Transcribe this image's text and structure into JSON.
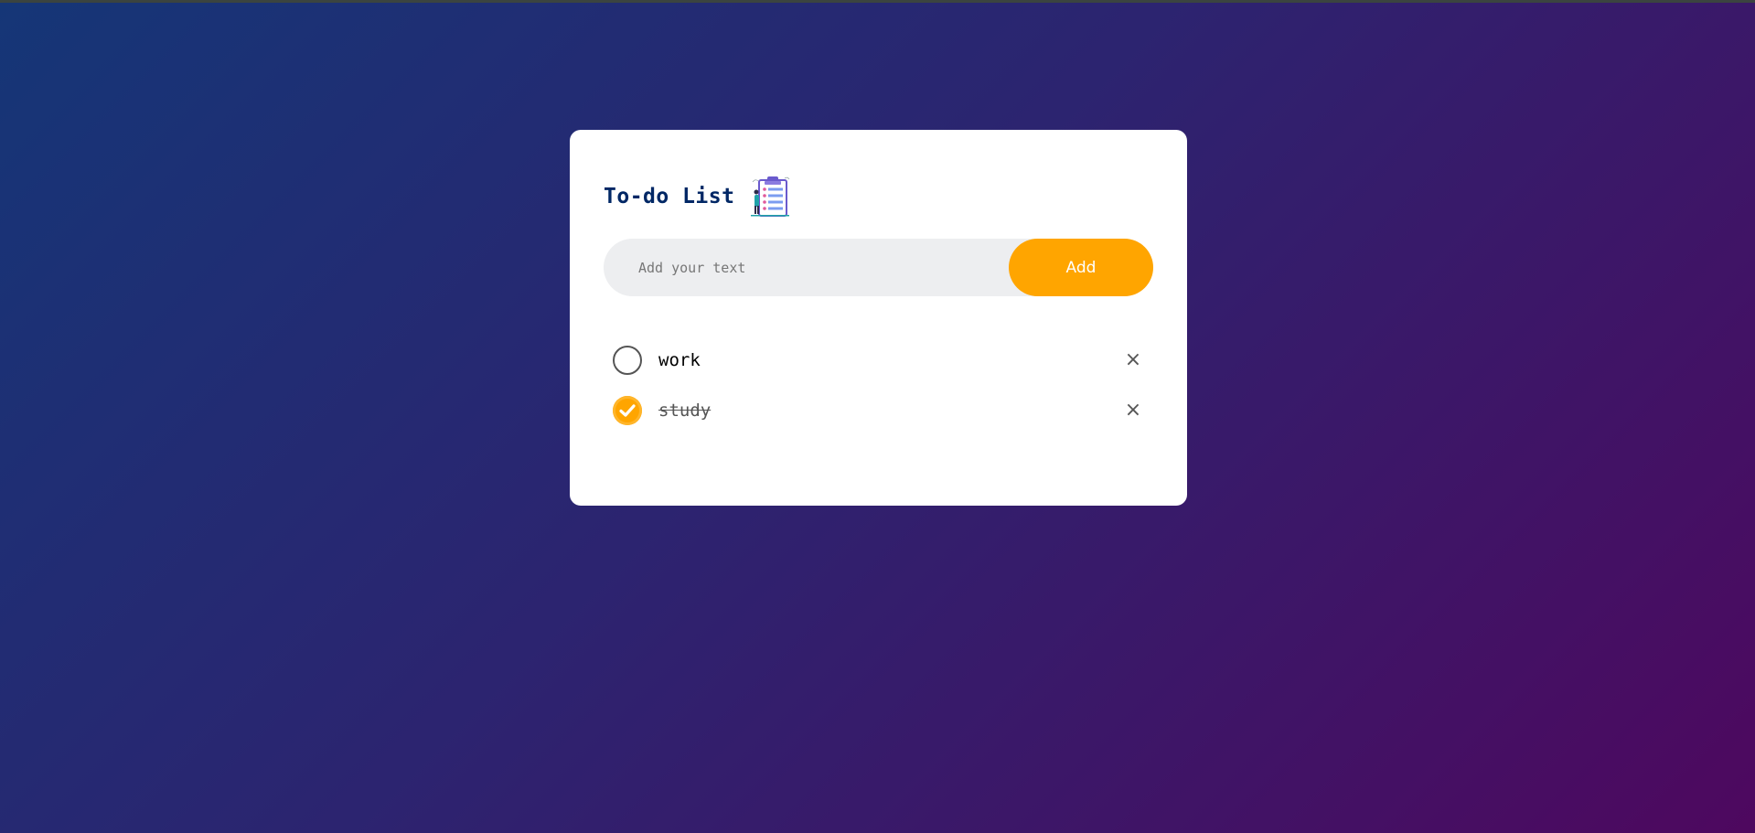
{
  "app": {
    "title": "To-do List",
    "title_icon": "clipboard-checklist-icon"
  },
  "input": {
    "value": "",
    "placeholder": "Add your text"
  },
  "add_button": {
    "label": "Add"
  },
  "tasks": [
    {
      "text": "work",
      "checked": false
    },
    {
      "text": "study",
      "checked": true
    }
  ],
  "icons": {
    "remove": "close-icon",
    "remove_glyph": "×",
    "checked": "check-circle-icon",
    "unchecked": "empty-circle-icon"
  },
  "colors": {
    "background_start": "#153677",
    "background_end": "#4e085f",
    "accent": "#ffa500",
    "title": "#002765",
    "input_bg": "#edeef0"
  }
}
